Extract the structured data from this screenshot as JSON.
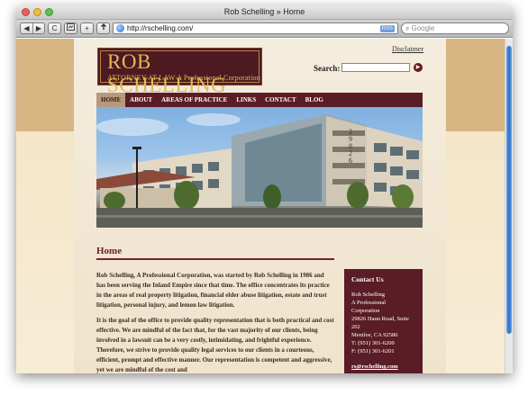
{
  "window": {
    "title": "Rob Schelling » Home"
  },
  "browser": {
    "back": "◀",
    "forward": "▶",
    "reload": "C",
    "addTab": "+",
    "url": "http://rschelling.com/",
    "rss": "RSS",
    "search_placeholder": "Google"
  },
  "site": {
    "logo_name": "ROB SCHELLING",
    "logo_tagline": "ATTORNEY AT LAW  A Professional Corporation",
    "disclaimer": "Disclaimer",
    "search_label": "Search:",
    "nav": [
      {
        "label": "HOME"
      },
      {
        "label": "ABOUT"
      },
      {
        "label": "AREAS OF PRACTICE"
      },
      {
        "label": "LINKS"
      },
      {
        "label": "CONTACT"
      },
      {
        "label": "BLOG"
      }
    ],
    "building_number": "29826",
    "heading": "Home",
    "paragraphs": [
      "Rob Schelling, A Professional Corporation, was started by Rob Schelling in 1986 and has been serving the Inland Empire since that time.  The office concentrates its practice in the areas of real property litigation, financial elder abuse litigation, estate and trust litigation, personal injury, and lemon law litigation.",
      "It is the goal of the office to provide quality representation that is both practical and cost effective.  We are mindful of the fact that, for the vast majority of our clients, being involved in a lawsuit can be a very costly, intimidating, and frightful experience.  Therefore, we strive to provide quality legal services to our clients in a courteous, efficient, prompt and effective manner.  Our representation is competent and aggressive, yet we are mindful of the cost and"
    ],
    "contact": {
      "title": "Contact Us",
      "lines": [
        "Rob Schelling",
        "A Professional",
        "Corporation",
        "29826 Haun Road, Suite 202",
        "Menifee, CA 92586",
        "T: (951) 301-6200",
        "F: (951) 301-6201"
      ],
      "email": "rs@rschelling.com"
    }
  }
}
